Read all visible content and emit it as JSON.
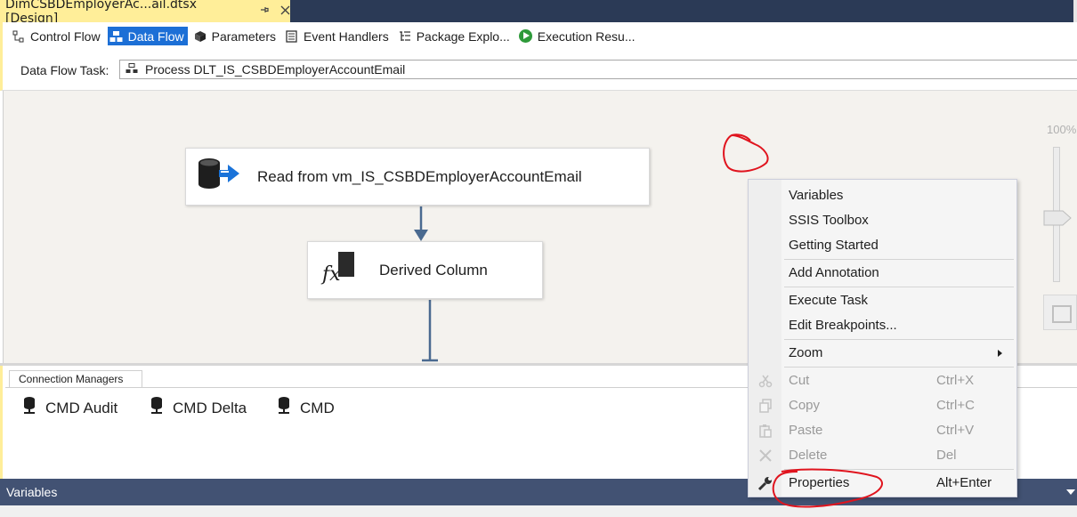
{
  "document_tab": {
    "title": "DimCSBDEmployerAc...ail.dtsx [Design]",
    "pin_glyph": "⊕",
    "close_glyph": "✕"
  },
  "designer_tabs": [
    {
      "label": "Control Flow",
      "icon": "control-flow-icon",
      "active": false
    },
    {
      "label": "Data Flow",
      "icon": "data-flow-icon",
      "active": true
    },
    {
      "label": "Parameters",
      "icon": "parameters-icon",
      "active": false
    },
    {
      "label": "Event Handlers",
      "icon": "event-handlers-icon",
      "active": false
    },
    {
      "label": "Package Explo...",
      "icon": "package-explorer-icon",
      "active": false
    },
    {
      "label": "Execution Resu...",
      "icon": "execution-results-icon",
      "active": false
    }
  ],
  "data_flow_task": {
    "label": "Data Flow Task:",
    "value": "Process DLT_IS_CSBDEmployerAccountEmail"
  },
  "components": {
    "source": {
      "label": "Read from vm_IS_CSBDEmployerAccountEmail",
      "icon": "ole-db-source-icon"
    },
    "derived": {
      "label": "Derived Column",
      "icon": "derived-column-icon"
    }
  },
  "zoom": {
    "level": "100%"
  },
  "connection_managers": {
    "tab_label": "Connection Managers",
    "items": [
      "CMD Audit",
      "CMD Delta",
      "CMD"
    ]
  },
  "variables_panel": {
    "title": "Variables"
  },
  "context_menu": {
    "items": [
      {
        "label": "Variables",
        "shortcut": "",
        "enabled": true
      },
      {
        "label": "SSIS Toolbox",
        "shortcut": "",
        "enabled": true
      },
      {
        "label": "Getting Started",
        "shortcut": "",
        "enabled": true
      },
      {
        "label": "Add Annotation",
        "shortcut": "",
        "enabled": true
      },
      {
        "label": "Execute Task",
        "shortcut": "",
        "enabled": true
      },
      {
        "label": "Edit Breakpoints...",
        "shortcut": "",
        "enabled": true
      },
      {
        "label": "Zoom",
        "shortcut": "",
        "enabled": true,
        "submenu": true
      },
      {
        "label": "Cut",
        "shortcut": "Ctrl+X",
        "enabled": false,
        "icon": "cut-icon"
      },
      {
        "label": "Copy",
        "shortcut": "Ctrl+C",
        "enabled": false,
        "icon": "copy-icon"
      },
      {
        "label": "Paste",
        "shortcut": "Ctrl+V",
        "enabled": false,
        "icon": "paste-icon"
      },
      {
        "label": "Delete",
        "shortcut": "Del",
        "enabled": false,
        "icon": "delete-icon"
      },
      {
        "label": "Properties",
        "shortcut": "Alt+Enter",
        "enabled": true,
        "icon": "wrench-icon"
      }
    ]
  },
  "colors": {
    "active_tab": "#1c6fd6",
    "document_tab": "#ffee99",
    "canvas": "#f4f2ee",
    "annotation_red": "#e0141e",
    "variables_bar": "#425273"
  }
}
